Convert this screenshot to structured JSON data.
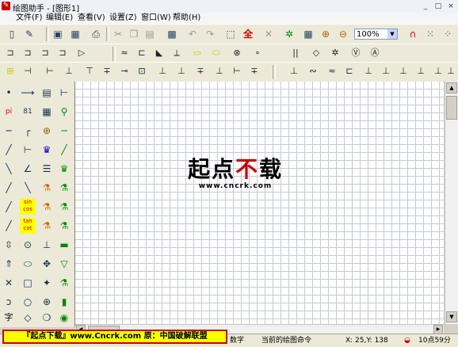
{
  "window": {
    "title": "绘图助手 - [图形1]",
    "controls": [
      "_",
      "□",
      "×"
    ]
  },
  "menu": [
    "文件(F)",
    "编辑(E)",
    "查看(V)",
    "设置(Z)",
    "窗口(W)",
    "帮助(H)"
  ],
  "toolbar_main": {
    "zoom_value": "100%",
    "icons": [
      "new-icon",
      "open-icon",
      "save-icon",
      "save-all-icon",
      "print-icon",
      "cut-icon",
      "copy-icon",
      "paste-icon",
      "insert-image-icon",
      "undo-icon",
      "redo-icon",
      "select-icon",
      "select-all-icon",
      "delete-icon",
      "gear-icon",
      "settings-icon",
      "zoom-in-icon",
      "zoom-out-icon",
      "magnet-icon",
      "grid-icon"
    ],
    "select_all_label": "全"
  },
  "toolbar_logic": {
    "symbols": [
      "⊐",
      "⊐",
      "⊐",
      "⊐",
      "▷",
      "≈",
      "⊏",
      "◣",
      "⟂",
      "▭",
      "⬭",
      "⊗",
      "∘",
      "||",
      "◇",
      "✲",
      "Ⓥ",
      "Ⓐ"
    ]
  },
  "toolbar_circuit": {
    "symbols": [
      "⊞",
      "⊣",
      "⊢",
      "⊥",
      "⊤",
      "∓",
      "⊸",
      "⊡",
      "⊥",
      "⊥",
      "∓",
      "⊥",
      "⊢",
      "∓",
      "⊥",
      "∾",
      "≈",
      "⊏",
      "⊥",
      "⊥",
      "⊥",
      "⊥",
      "⊥",
      "⊥"
    ]
  },
  "left_tools": {
    "col1": [
      "•",
      "pi",
      "─",
      "╱",
      "╲",
      "╱",
      "╱",
      "╱",
      "⇳",
      "⇑",
      "✕",
      "ↄ",
      "字"
    ],
    "col2": [
      "⟶",
      "81",
      "┌",
      "⊢",
      "∠",
      "╲",
      "sin cos",
      "tan cot",
      "⊙",
      "⬭",
      "□",
      "○",
      "◇"
    ],
    "col3": [
      "▤",
      "▦",
      "⊕",
      "♛",
      "☰",
      "⚗",
      "⚗",
      "⚗",
      "⊥",
      "✥",
      "✦",
      "⊕",
      "❍",
      "◈",
      "▭"
    ],
    "col4": [
      "⊢",
      "⚲",
      "─",
      "╱",
      "♛",
      "⚗",
      "⚗",
      "⚗",
      "▬",
      "▽",
      "⚗",
      "▮",
      "◉",
      "▭"
    ]
  },
  "watermark": {
    "brand_part1": "起点",
    "brand_accent": "不",
    "brand_part2": "载",
    "url": "www.cncrk.com"
  },
  "banner": {
    "text": "『起点下载』www.Cncrk.com 原：中国破解联盟"
  },
  "status": {
    "segment_1": "数字",
    "segment_2": "当前的绘图命令",
    "coords": "X:  25,Y: 138",
    "time": "10点59分"
  }
}
